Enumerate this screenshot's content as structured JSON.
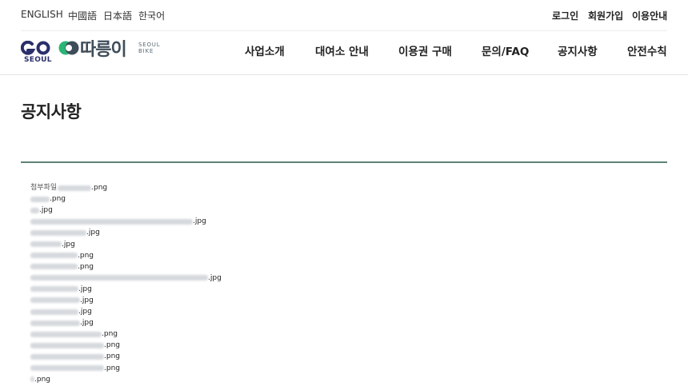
{
  "languages": [
    "ENGLISH",
    "中國語",
    "日本語",
    "한국어"
  ],
  "utility": {
    "login": "로그인",
    "signup": "회원가입",
    "guide": "이용안내"
  },
  "brand": {
    "seoul": "SEOUL",
    "name": "따릉이",
    "sub_line1": "SEOUL",
    "sub_line2": "BIKE"
  },
  "nav": [
    "사업소개",
    "대여소 안내",
    "이용권 구매",
    "문의/FAQ",
    "공지사항",
    "안전수칙"
  ],
  "page_title": "공지사항",
  "attachments": {
    "label": "첨부파일",
    "files": [
      {
        "ext": ".png"
      },
      {
        "ext": ".png"
      },
      {
        "ext": ".jpg"
      },
      {
        "ext": ".jpg"
      },
      {
        "ext": ".jpg"
      },
      {
        "ext": ".jpg"
      },
      {
        "ext": ".png"
      },
      {
        "ext": ".png"
      },
      {
        "ext": ".jpg"
      },
      {
        "ext": ".jpg"
      },
      {
        "ext": ".jpg"
      },
      {
        "ext": ".jpg"
      },
      {
        "ext": ".jpg"
      },
      {
        "ext": ".png"
      },
      {
        "ext": ".png"
      },
      {
        "ext": ".png"
      },
      {
        "ext": ".png"
      },
      {
        "ext": ".png"
      }
    ]
  },
  "colors": {
    "brand_navy": "#2a2f6b",
    "brand_green": "#2bb673",
    "brand_slate": "#3e4d59",
    "title_rule": "#5f8177"
  }
}
